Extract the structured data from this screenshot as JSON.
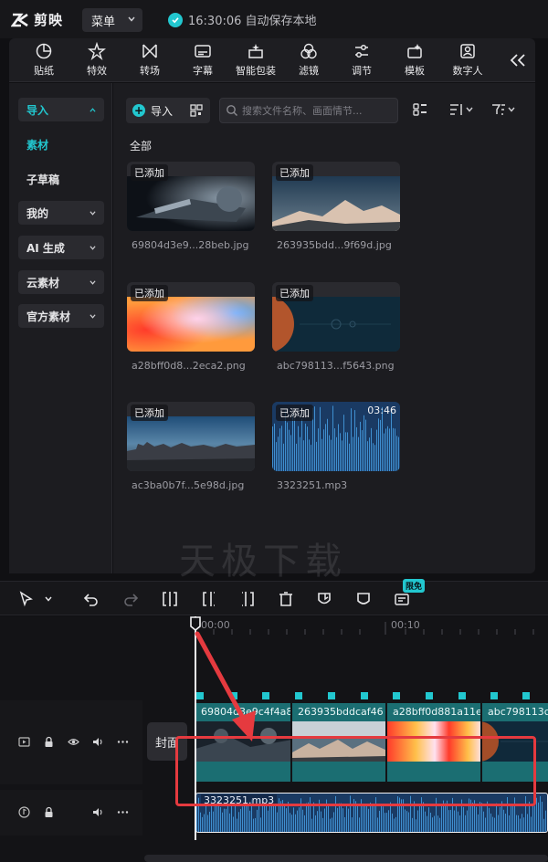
{
  "app": {
    "name": "剪映",
    "menu_label": "菜单",
    "save_status": "16:30:06 自动保存本地"
  },
  "toolbar": {
    "items": [
      {
        "label": "贴纸",
        "icon": "sticker-icon"
      },
      {
        "label": "特效",
        "icon": "effects-icon"
      },
      {
        "label": "转场",
        "icon": "transition-icon"
      },
      {
        "label": "字幕",
        "icon": "subtitle-icon"
      },
      {
        "label": "智能包装",
        "icon": "smart-package-icon"
      },
      {
        "label": "滤镜",
        "icon": "filter-icon"
      },
      {
        "label": "调节",
        "icon": "adjust-icon"
      },
      {
        "label": "模板",
        "icon": "template-icon"
      },
      {
        "label": "数字人",
        "icon": "digital-human-icon"
      }
    ]
  },
  "leftnav": {
    "items": [
      {
        "label": "导入",
        "style": "active-boxed"
      },
      {
        "label": "素材",
        "style": "active"
      },
      {
        "label": "子草稿",
        "style": "plain"
      },
      {
        "label": "我的",
        "style": "boxed"
      },
      {
        "label": "AI 生成",
        "style": "boxed"
      },
      {
        "label": "云素材",
        "style": "boxed"
      },
      {
        "label": "官方素材",
        "style": "boxed"
      }
    ]
  },
  "media": {
    "import_label": "导入",
    "search_placeholder": "搜索文件名称、画面情节...",
    "section_label": "全部",
    "items": [
      {
        "badge": "已添加",
        "filename": "69804d3e9...28beb.jpg",
        "duration": ""
      },
      {
        "badge": "已添加",
        "filename": "263935bdd...9f69d.jpg",
        "duration": ""
      },
      {
        "badge": "已添加",
        "filename": "a28bff0d8...2eca2.png",
        "duration": ""
      },
      {
        "badge": "已添加",
        "filename": "abc798113...f5643.png",
        "duration": ""
      },
      {
        "badge": "已添加",
        "filename": "ac3ba0b7f...5e98d.jpg",
        "duration": ""
      },
      {
        "badge": "已添加",
        "filename": "3323251.mp3",
        "duration": "03:46"
      }
    ]
  },
  "watermark": "天极下载",
  "timeline": {
    "free_badge": "限免",
    "ruler_labels": [
      "00:00",
      "00:10"
    ],
    "cover_label": "封面",
    "clips": [
      {
        "label": "69804d3e9c4f4a8"
      },
      {
        "label": "263935bddcaf46"
      },
      {
        "label": "a28bff0d881a11e"
      },
      {
        "label": "abc798113c"
      }
    ],
    "audio_label": "3323251.mp3"
  },
  "colors": {
    "accent": "#22c7cf",
    "highlight": "#e53a3f",
    "clip": "#1b6e72",
    "audio": "#1a3a63"
  }
}
